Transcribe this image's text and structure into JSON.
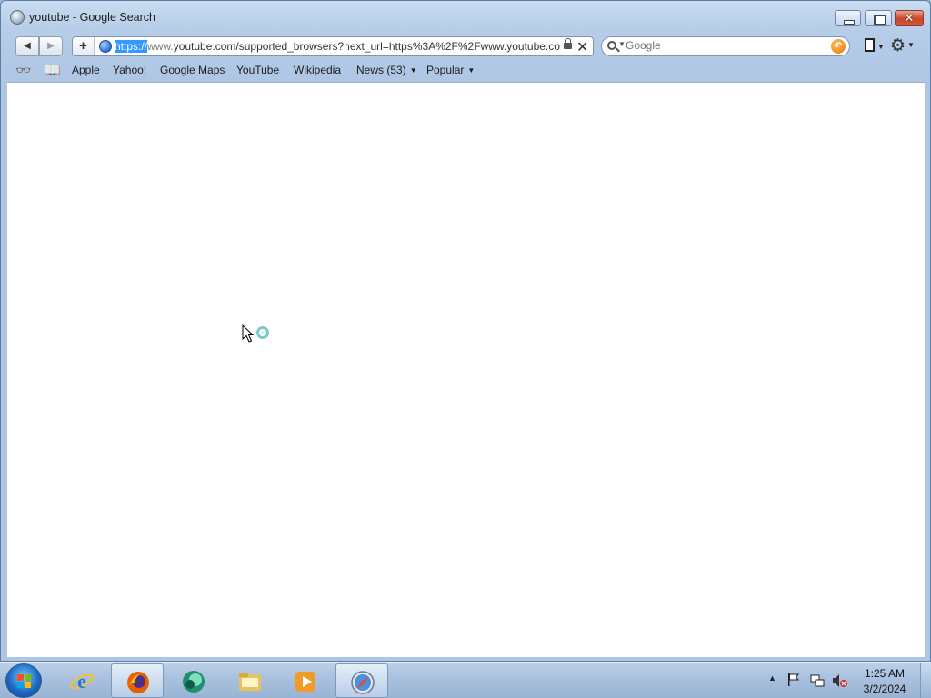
{
  "window": {
    "title": "youtube - Google Search"
  },
  "toolbar": {
    "back_label": "◀",
    "forward_label": "▶",
    "add_label": "+",
    "url_selected": "https://",
    "url_dim": "www.",
    "url_rest": "youtube.com/supported_browsers?next_url=https%3A%2F%2Fwww.youtube.co",
    "stop_label": "✕",
    "search_placeholder": "Google"
  },
  "bookmarks": {
    "items": [
      {
        "label": "Apple"
      },
      {
        "label": "Yahoo!"
      },
      {
        "label": "Google Maps"
      },
      {
        "label": "YouTube"
      },
      {
        "label": "Wikipedia"
      },
      {
        "label": "News (53)"
      },
      {
        "label": "Popular"
      }
    ]
  },
  "taskbar": {
    "apps": [
      "internet-explorer",
      "firefox",
      "messenger",
      "file-explorer",
      "media-player",
      "safari"
    ],
    "active_app": "safari",
    "time": "1:25 AM",
    "date": "3/2/2024"
  },
  "colors": {
    "selection": "#3399ff",
    "close_button": "#c9442a",
    "taskbar": "#a9c1de"
  }
}
